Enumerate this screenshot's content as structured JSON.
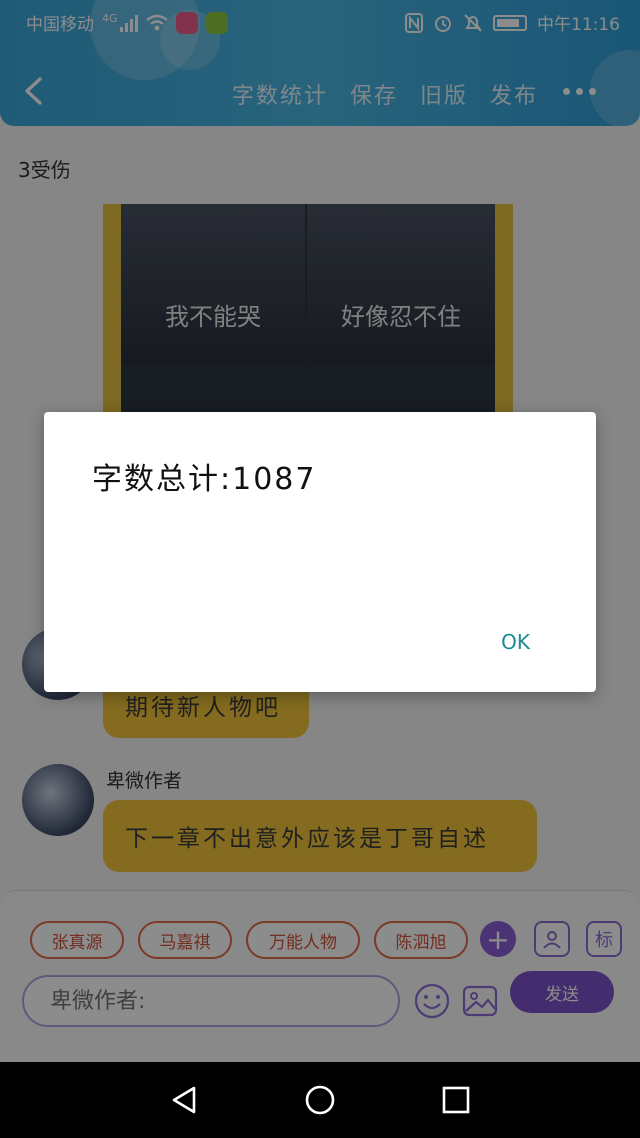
{
  "status_bar": {
    "carrier": "中国移动",
    "network": "4G",
    "time": "中午11:16"
  },
  "header": {
    "actions": [
      "字数统计",
      "保存",
      "旧版",
      "发布"
    ],
    "back_icon": "chevron-left-icon",
    "more_icon": "more-horizontal-icon"
  },
  "content": {
    "chapter_title": "3受伤",
    "image_captions": [
      "我不能哭",
      "好像忍不住"
    ],
    "messages": [
      {
        "text": "期待新人物吧"
      },
      {
        "author": "卑微作者",
        "text": "下一章不出意外应该是丁哥自述"
      }
    ]
  },
  "input_bar": {
    "characters": [
      "张真源",
      "马嘉祺",
      "万能人物",
      "陈泗旭"
    ],
    "placeholder": "卑微作者:",
    "send_label": "发送",
    "tag_label": "标"
  },
  "dialog": {
    "message": "字数总计:1087",
    "ok_label": "OK"
  },
  "colors": {
    "header": "#3aa6d8",
    "bubble": "#f0c43a",
    "accent": "#7b52c9",
    "chip_border": "#e06a4a",
    "ok": "#1b8a93"
  }
}
